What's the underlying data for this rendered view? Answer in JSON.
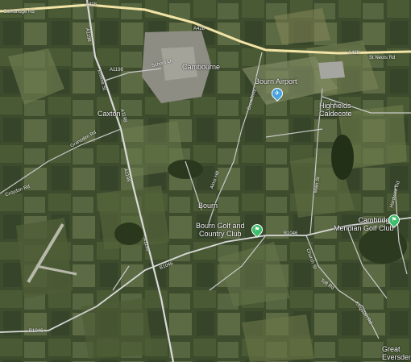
{
  "places": {
    "cambourne": "Cambourne",
    "caxton": "Caxton",
    "bourn": "Bourn",
    "bourn_airport": "Bourn Airport",
    "highfields_line1": "Highfields",
    "highfields_line2": "Caldecote",
    "great_eversden_line1": "Great",
    "great_eversden_line2": "Eversden"
  },
  "pois": {
    "bourn_golf_line1": "Bourn Golf and",
    "bourn_golf_line2": "Country Club",
    "cambridge_meridian_line1": "Cambridge",
    "cambridge_meridian_line2": "Meridian Golf Club"
  },
  "roads": {
    "cambridge_rd": "Cambridge Rd",
    "a428_west": "A428",
    "a428_mid": "A428",
    "a428_east": "A428",
    "st_neots_rd": "St Neots Rd",
    "a1198_north": "A1198",
    "a1198_mid": "A1198",
    "a1198_south": "A1198",
    "a1198_far": "A1198",
    "ermine_st": "Ermine St",
    "school_ln": "School Ln",
    "gransden_rd": "Gransden Rd",
    "croydon_rd": "Croydon Rd",
    "broadway": "Broadway",
    "alms_hill": "Alms Hill",
    "b1046_east": "B1046",
    "b1046_mid": "B1046",
    "b1046_west": "B1046",
    "main_st": "Main St",
    "church_st": "Church St",
    "toft_rd": "Toft Rd",
    "kingston_rd": "Kingston Rd",
    "hardwick_rd": "Hardwick Rd",
    "a1198_west": "A1198"
  },
  "colors": {
    "farmland": "#3b4a2c",
    "road_major": "#d9d9d9",
    "road_minor": "#c9c9c9",
    "a428": "#f2e3a6",
    "airport_pin": "#4aa3df",
    "golf_pin": "#3ebd6a"
  },
  "icons": {
    "airport": "airplane-icon",
    "golf": "golf-flag-icon"
  }
}
